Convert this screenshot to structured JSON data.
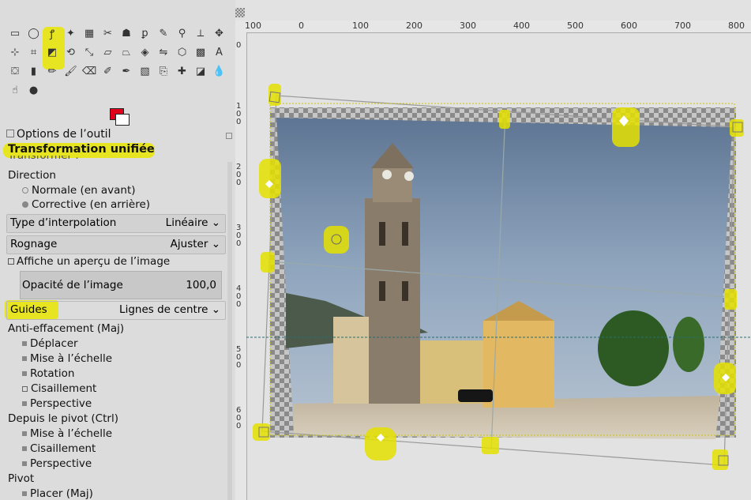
{
  "toolbox": {
    "tools": [
      {
        "icon": "rect-select-icon",
        "glyph": "▭"
      },
      {
        "icon": "ellipse-select-icon",
        "glyph": "◯"
      },
      {
        "icon": "free-select-icon",
        "glyph": "ꝭ"
      },
      {
        "icon": "fuzzy-select-icon",
        "glyph": "✦"
      },
      {
        "icon": "select-by-color-icon",
        "glyph": "▦"
      },
      {
        "icon": "scissors-icon",
        "glyph": "✂"
      },
      {
        "icon": "foreground-select-icon",
        "glyph": "☗"
      },
      {
        "icon": "paths-icon",
        "glyph": "ꝑ"
      },
      {
        "icon": "color-picker-icon",
        "glyph": "✎"
      },
      {
        "icon": "zoom-icon",
        "glyph": "⚲"
      },
      {
        "icon": "measure-icon",
        "glyph": "⟂"
      },
      {
        "icon": "move-icon",
        "glyph": "✥"
      },
      {
        "icon": "align-icon",
        "glyph": "⊹"
      },
      {
        "icon": "crop-icon",
        "glyph": "⌗"
      },
      {
        "icon": "unified-transform-icon",
        "glyph": "◩"
      },
      {
        "icon": "rotate-icon",
        "glyph": "⟲"
      },
      {
        "icon": "scale-icon",
        "glyph": "⤡"
      },
      {
        "icon": "shear-icon",
        "glyph": "▱"
      },
      {
        "icon": "perspective-icon",
        "glyph": "⏢"
      },
      {
        "icon": "3d-transform-icon",
        "glyph": "◈"
      },
      {
        "icon": "flip-icon",
        "glyph": "⇋"
      },
      {
        "icon": "cage-icon",
        "glyph": "⬡"
      },
      {
        "icon": "warp-icon",
        "glyph": "▩"
      },
      {
        "icon": "text-icon",
        "glyph": "A"
      },
      {
        "icon": "bucket-fill-icon",
        "glyph": "⛋"
      },
      {
        "icon": "gradient-icon",
        "glyph": "▮"
      },
      {
        "icon": "pencil-icon",
        "glyph": "✏"
      },
      {
        "icon": "paintbrush-icon",
        "glyph": "🖌"
      },
      {
        "icon": "eraser-icon",
        "glyph": "⌫"
      },
      {
        "icon": "airbrush-icon",
        "glyph": "✐"
      },
      {
        "icon": "ink-icon",
        "glyph": "✒"
      },
      {
        "icon": "mypaint-brush-icon",
        "glyph": "▧"
      },
      {
        "icon": "clone-icon",
        "glyph": "⎘"
      },
      {
        "icon": "heal-icon",
        "glyph": "✚"
      },
      {
        "icon": "perspective-clone-icon",
        "glyph": "◪"
      },
      {
        "icon": "blur-icon",
        "glyph": "💧"
      },
      {
        "icon": "smudge-icon",
        "glyph": "☝"
      },
      {
        "icon": "dodge-burn-icon",
        "glyph": "●"
      }
    ],
    "colors": {
      "foreground": "#e0001b",
      "background": "#ffffff"
    }
  },
  "tool_options": {
    "tab_label": "Options de l’outil",
    "title": "Transformation unifiée",
    "transform_label": "Transformer :",
    "direction_label": "Direction",
    "direction_normal": "Normale (en avant)",
    "direction_corrective": "Corrective (en arrière)",
    "interpolation_label": "Type d’interpolation",
    "interpolation_value": "Linéaire",
    "clipping_label": "Rognage",
    "clipping_value": "Ajuster",
    "preview_label": "Affiche un aperçu de l’image",
    "opacity_label": "Opacité de l’image",
    "opacity_value": "100,0",
    "guides_label": "Guides",
    "guides_value": "Lignes de centre",
    "constrain_label": "Anti-effacement (Maj)",
    "constrain_move": "Déplacer",
    "constrain_scale": "Mise à l’échelle",
    "constrain_rotate": "Rotation",
    "constrain_shear": "Cisaillement",
    "constrain_perspective": "Perspective",
    "from_pivot_label": "Depuis le pivot  (Ctrl)",
    "pivot_scale": "Mise à l’échelle",
    "pivot_shear": "Cisaillement",
    "pivot_perspective": "Perspective",
    "pivot_label": "Pivot",
    "pivot_place": "Placer (Maj)"
  },
  "canvas": {
    "hruler_labels": [
      "100",
      "0",
      "100",
      "200",
      "300",
      "400",
      "500",
      "600",
      "700",
      "800"
    ],
    "vruler_labels": [
      "0",
      "100",
      "200",
      "300",
      "400",
      "500",
      "600"
    ],
    "highlight_color": "#e9e600"
  }
}
